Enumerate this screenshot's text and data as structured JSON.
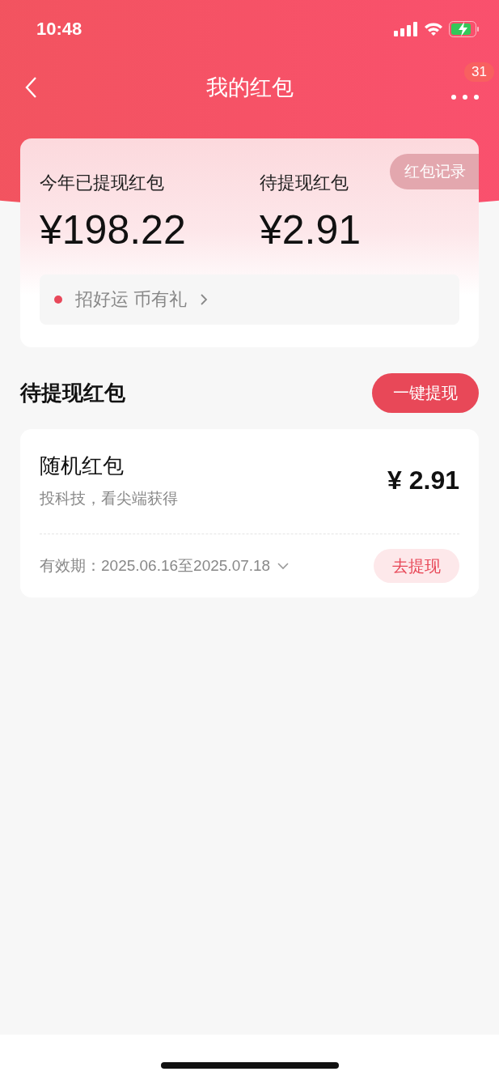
{
  "status_bar": {
    "time": "10:48"
  },
  "nav": {
    "title": "我的红包",
    "badge": "31"
  },
  "summary": {
    "record_button": "红包记录",
    "stats": [
      {
        "label": "今年已提现红包",
        "amount": "¥198.22"
      },
      {
        "label": "待提现红包",
        "amount": "¥2.91"
      }
    ],
    "promo": {
      "text": "招好运 币有礼",
      "color": "#e8485a"
    }
  },
  "section": {
    "title": "待提现红包",
    "button": "一键提现"
  },
  "packets": [
    {
      "title": "随机红包",
      "subtitle": "投科技，看尖端获得",
      "amount": "¥ 2.91",
      "validity": "有效期：2025.06.16至2025.07.18",
      "action": "去提现"
    }
  ]
}
